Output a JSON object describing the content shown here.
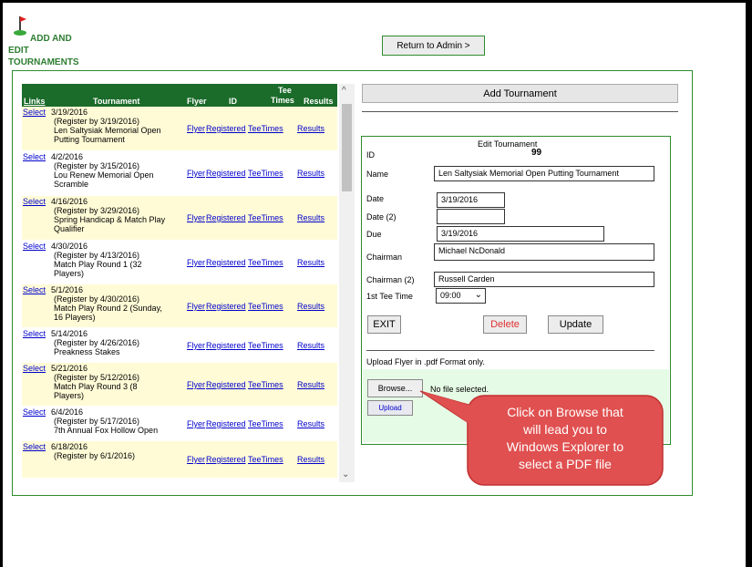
{
  "header": {
    "title_line1": "ADD AND",
    "title_line2": "EDIT",
    "title_line3": "TOURNAMENTS",
    "return_label": "Return to Admin >"
  },
  "grid": {
    "columns": {
      "links": "Links",
      "tournament": "Tournament",
      "flyer": "Flyer",
      "id": "ID",
      "tee_line1": "Tee",
      "tee_line2": "Times",
      "results": "Results"
    },
    "rows": [
      {
        "select": "Select",
        "date": "3/19/2016",
        "lines": [
          "(Register by 3/19/2016)",
          "Len Saltysiak Memorial Open",
          "Putting Tournament"
        ]
      },
      {
        "select": "Select",
        "date": "4/2/2016",
        "lines": [
          "(Register by 3/15/2016)",
          "Lou Renew Memorial Open",
          "Scramble"
        ]
      },
      {
        "select": "Select",
        "date": "4/16/2016",
        "lines": [
          "(Register by 3/29/2016)",
          "Spring Handicap & Match Play",
          "Qualifier"
        ]
      },
      {
        "select": "Select",
        "date": "4/30/2016",
        "lines": [
          "(Register by 4/13/2016)",
          "Match Play Round 1 (32",
          "Players)"
        ]
      },
      {
        "select": "Select",
        "date": "5/1/2016",
        "lines": [
          "(Register by 4/30/2016)",
          "Match Play Round 2 (Sunday,",
          "16 Players)"
        ]
      },
      {
        "select": "Select",
        "date": "5/14/2016",
        "lines": [
          "(Register by 4/26/2016)",
          "Preakness Stakes"
        ]
      },
      {
        "select": "Select",
        "date": "5/21/2016",
        "lines": [
          "(Register by 5/12/2016)",
          "Match Play Round 3 (8",
          "Players)"
        ]
      },
      {
        "select": "Select",
        "date": "6/4/2016",
        "lines": [
          "(Register by 5/17/2016)",
          "7th Annual Fox Hollow Open"
        ]
      },
      {
        "select": "Select",
        "date": "6/18/2016",
        "lines": [
          "(Register by 6/1/2016)"
        ]
      }
    ],
    "links": {
      "flyer": "Flyer",
      "registered": "Registered",
      "teetimes": "TeeTimes",
      "results": "Results"
    }
  },
  "right": {
    "add_label": "Add Tournament"
  },
  "edit": {
    "heading": "Edit Tournament",
    "id_label": "ID",
    "id_value": "99",
    "name_label": "Name",
    "name_value": "Len Saltysiak Memorial Open Putting Tournament",
    "date_label": "Date",
    "date_value": "3/19/2016",
    "date2_label": "Date (2)",
    "date2_value": "",
    "due_label": "Due",
    "due_value": "3/19/2016",
    "chair_label": "Chairman",
    "chair_value": "Michael NcDonald",
    "chair2_label": "Chairman (2)",
    "chair2_value": "Russell Carden",
    "tee_label": "1st Tee Time",
    "tee_value": "09:00",
    "exit_label": "EXIT",
    "delete_label": "Delete",
    "update_label": "Update",
    "upload_note": "Upload Flyer in .pdf Format only.",
    "browse_label": "Browse...",
    "no_file": "No file selected.",
    "upload_label": "Upload"
  },
  "callout": {
    "lines": [
      "Click on Browse that",
      "will lead you to",
      "Windows Explorer to",
      "select a PDF file"
    ]
  },
  "colors": {
    "green": "#1b6b2a",
    "link": "#0000cc",
    "callout_fill": "#e05050",
    "delete": "#e03030"
  }
}
